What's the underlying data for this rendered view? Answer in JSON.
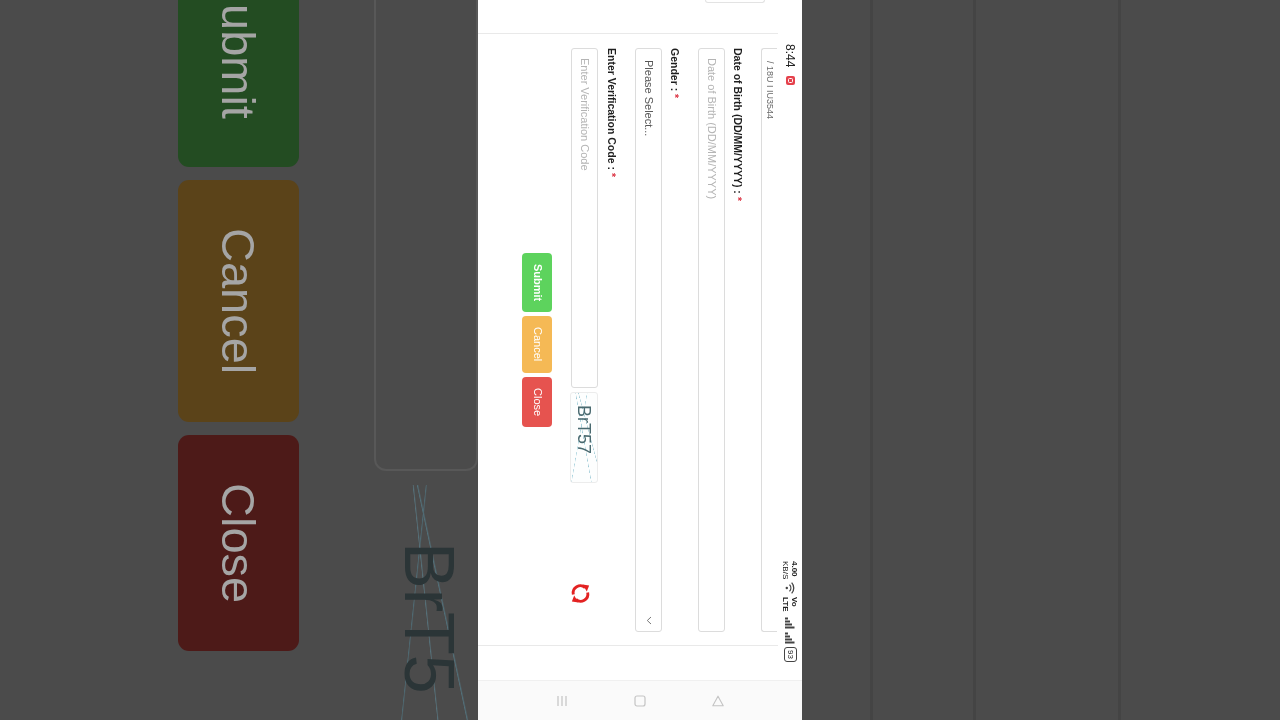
{
  "backdrop": {
    "buttons": [
      {
        "label": "ubmit",
        "kind": "submit"
      },
      {
        "label": "Cancel",
        "kind": "cancel"
      },
      {
        "label": "Close",
        "kind": "close"
      }
    ],
    "captcha_text": "BrT5"
  },
  "status_bar": {
    "time": "8:44",
    "network_speed": "4.00",
    "network_speed_unit": "KB/S",
    "network_type": "Vo LTE",
    "battery": "93"
  },
  "form": {
    "fields": [
      {
        "kind": "text",
        "value": "/ 18U I IU3544"
      },
      {
        "kind": "text",
        "label": "Date of Birth (DD/MM/YYYY) :",
        "required_mark": "*",
        "placeholder": "Date of Birth (DD/MM/YYYY)"
      },
      {
        "kind": "select",
        "label": "Gender :",
        "required_mark": "*",
        "value": "Please Select..."
      },
      {
        "kind": "captcha",
        "label": "Enter Verification Code :",
        "required_mark": "*",
        "placeholder": "Enter Verification Code",
        "captcha_text": "BrT57"
      }
    ],
    "buttons": [
      {
        "label": "Submit",
        "kind": "submit"
      },
      {
        "label": "Cancel",
        "kind": "cancel"
      },
      {
        "label": "Close",
        "kind": "close"
      }
    ]
  }
}
